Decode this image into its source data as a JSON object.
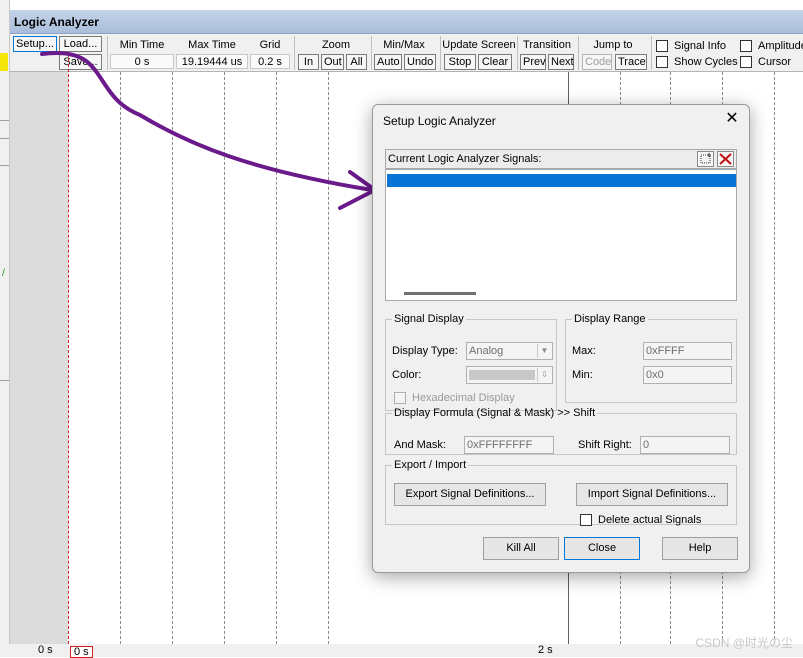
{
  "window": {
    "title": "Logic Analyzer"
  },
  "toolbar": {
    "setup": "Setup...",
    "load": "Load...",
    "save": "Save...",
    "min_time": {
      "label": "Min Time",
      "value": "0 s"
    },
    "max_time": {
      "label": "Max Time",
      "value": "19.19444 us"
    },
    "grid": {
      "label": "Grid",
      "value": "0.2 s"
    },
    "zoom": {
      "label": "Zoom",
      "in": "In",
      "out": "Out",
      "all": "All"
    },
    "minmax": {
      "label": "Min/Max",
      "auto": "Auto",
      "undo": "Undo"
    },
    "update": {
      "label": "Update Screen",
      "stop": "Stop",
      "clear": "Clear"
    },
    "transition": {
      "label": "Transition",
      "prev": "Prev",
      "next": "Next"
    },
    "jump": {
      "label": "Jump to",
      "code": "Code",
      "trace": "Trace"
    },
    "options": {
      "signal_info": "Signal Info",
      "show_cycles": "Show Cycles",
      "amplitude": "Amplitude",
      "cursor": "Cursor"
    }
  },
  "plot": {
    "time_start": "0 s",
    "cursor_time": "0 s",
    "time_mid": "2 s"
  },
  "dialog": {
    "title": "Setup Logic Analyzer",
    "close": "✕",
    "signals_label": "Current Logic Analyzer Signals:",
    "signal_display": {
      "legend": "Signal Display",
      "type_label": "Display Type:",
      "type_value": "Analog",
      "color_label": "Color:",
      "hex_label": "Hexadecimal Display"
    },
    "display_range": {
      "legend": "Display Range",
      "max_label": "Max:",
      "max_value": "0xFFFF",
      "min_label": "Min:",
      "min_value": "0x0"
    },
    "formula": {
      "legend": "Display Formula (Signal & Mask) >> Shift",
      "and_label": "And Mask:",
      "and_value": "0xFFFFFFFF",
      "shift_label": "Shift Right:",
      "shift_value": "0"
    },
    "export_import": {
      "legend": "Export / Import",
      "export": "Export Signal Definitions...",
      "import": "Import Signal Definitions...",
      "delete": "Delete actual Signals"
    },
    "buttons": {
      "kill_all": "Kill All",
      "close": "Close",
      "help": "Help"
    }
  },
  "colors": {
    "annotation_arrow": "#6a1a8a",
    "selection": "#0a74d6",
    "cursor": "#d42020"
  },
  "watermark": "CSDN @时光の尘"
}
